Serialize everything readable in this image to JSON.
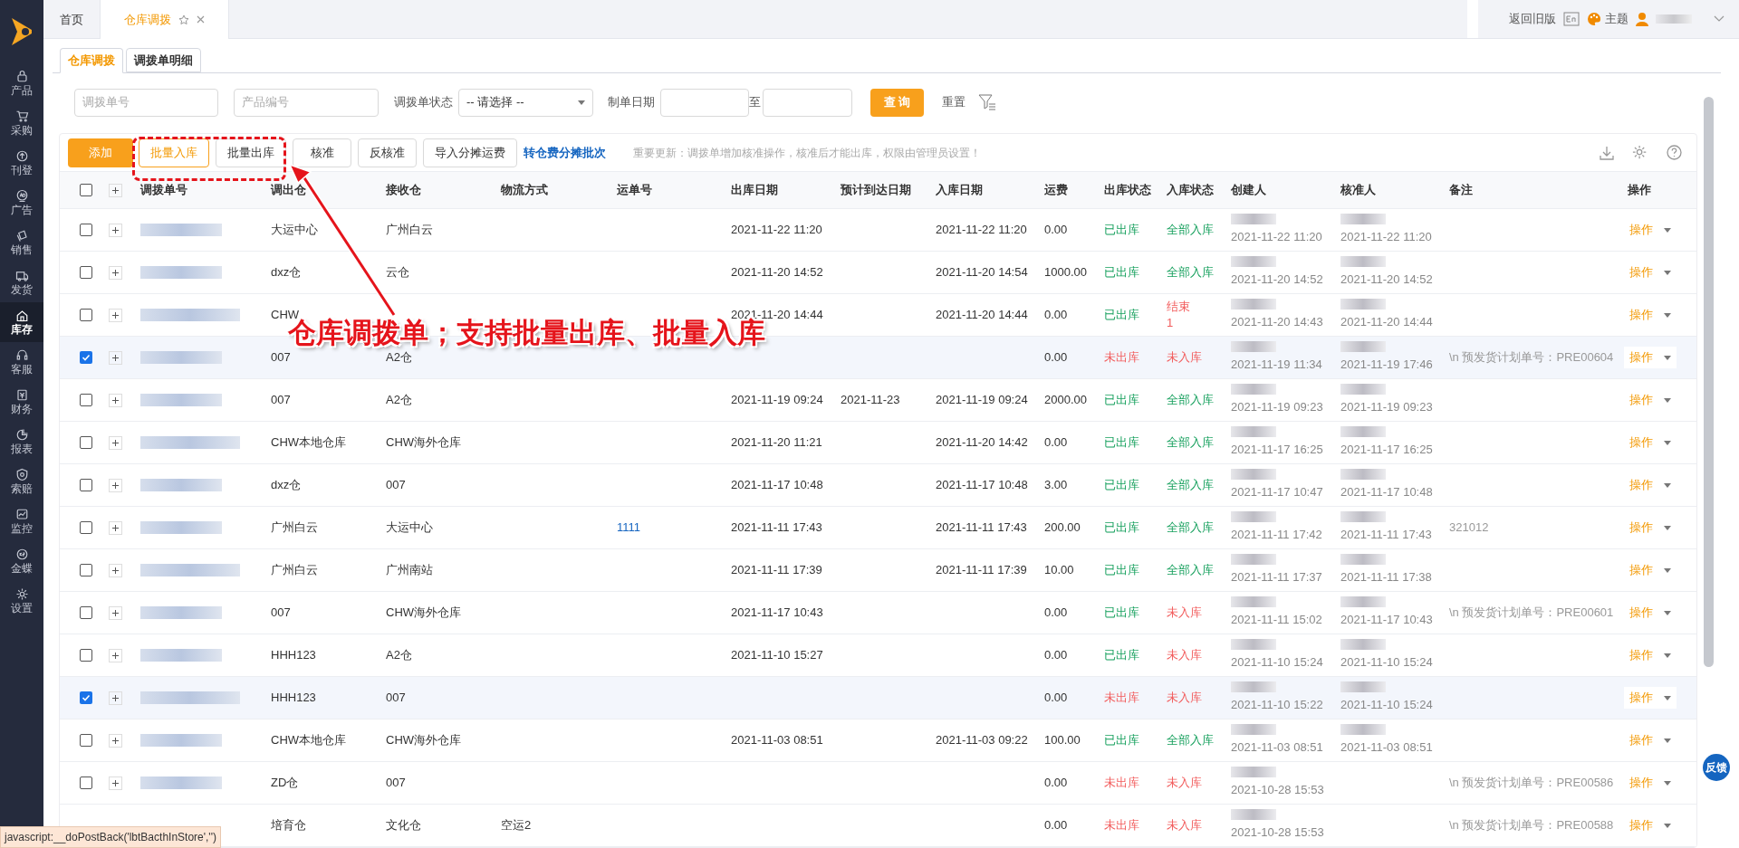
{
  "sidebar": {
    "items": [
      {
        "label": "产品",
        "selected": false
      },
      {
        "label": "采购",
        "selected": false
      },
      {
        "label": "刊登",
        "selected": false
      },
      {
        "label": "广告",
        "selected": false
      },
      {
        "label": "销售",
        "selected": false
      },
      {
        "label": "发货",
        "selected": false
      },
      {
        "label": "库存",
        "selected": true
      },
      {
        "label": "客服",
        "selected": false
      },
      {
        "label": "财务",
        "selected": false
      },
      {
        "label": "报表",
        "selected": false
      },
      {
        "label": "索赔",
        "selected": false
      },
      {
        "label": "监控",
        "selected": false
      },
      {
        "label": "金蝶",
        "selected": false
      },
      {
        "label": "设置",
        "selected": false
      }
    ]
  },
  "page_tabs": [
    {
      "label": "首页",
      "selected": false,
      "closable": false
    },
    {
      "label": "仓库调拨",
      "selected": true,
      "closable": true
    }
  ],
  "header_right": {
    "old_version": "返回旧版",
    "theme": "主题"
  },
  "sub_tabs": [
    {
      "label": "仓库调拨",
      "selected": true
    },
    {
      "label": "调拨单明细",
      "selected": false
    }
  ],
  "filters": {
    "order_no": {
      "placeholder": "调拨单号"
    },
    "product_no": {
      "placeholder": "产品编号"
    },
    "status_label": "调拨单状态",
    "status_select": "-- 请选择 --",
    "date_label": "制单日期",
    "date_to": "至",
    "query": "查 询",
    "reset": "重置"
  },
  "toolbar": {
    "buttons": [
      {
        "label": "添加",
        "kind": "primary"
      },
      {
        "label": "批量入库",
        "kind": "outline"
      },
      {
        "label": "批量出库",
        "kind": "plain"
      },
      {
        "label": "核准",
        "kind": "plain"
      },
      {
        "label": "反核准",
        "kind": "plain"
      },
      {
        "label": "导入分摊运费",
        "kind": "plain"
      },
      {
        "label": "转仓费分摊批次",
        "kind": "link"
      }
    ],
    "notice": "重要更新：调拨单增加核准操作，核准后才能出库，权限由管理员设置！"
  },
  "table": {
    "select_all": {
      "checked": false
    },
    "columns": [
      "调拨单号",
      "调出仓",
      "接收仓",
      "物流方式",
      "运单号",
      "出库日期",
      "预计到达日期",
      "入库日期",
      "运费",
      "出库状态",
      "入库状态",
      "创建人",
      "核准人",
      "备注",
      "操作"
    ],
    "rows": [
      {
        "checked": false,
        "from": "大运中心",
        "to": "广州白云",
        "out_date": "2021-11-22 11:20",
        "in_date": "2021-11-22 11:20",
        "freight": "0.00",
        "out_status": {
          "text": "已出库",
          "kind": "ok"
        },
        "in_status": {
          "text": "全部入库",
          "kind": "ok"
        },
        "created": "2021-11-22 11:20",
        "approved": "2021-11-22 11:20",
        "action": "操作"
      },
      {
        "checked": false,
        "from": "dxz仓",
        "to": "云仓",
        "out_date": "2021-11-20 14:52",
        "in_date": "2021-11-20 14:54",
        "freight": "1000.00",
        "out_status": {
          "text": "已出库",
          "kind": "ok"
        },
        "in_status": {
          "text": "全部入库",
          "kind": "ok"
        },
        "created": "2021-11-20 14:52",
        "approved": "2021-11-20 14:52",
        "action": "操作"
      },
      {
        "checked": false,
        "from": "CHW",
        "out_date": "2021-11-20 14:44",
        "in_date": "2021-11-20 14:44",
        "freight": "0.00",
        "out_status": {
          "text": "已出库",
          "kind": "ok"
        },
        "in_status": {
          "text": "结束",
          "sub": "1",
          "kind": "warn"
        },
        "created": "2021-11-20 14:43",
        "approved": "2021-11-20 14:44",
        "action": "操作"
      },
      {
        "checked": true,
        "from": "007",
        "to": "A2仓",
        "freight": "0.00",
        "out_status": {
          "text": "未出库",
          "kind": "warn"
        },
        "in_status": {
          "text": "未入库",
          "kind": "warn"
        },
        "created": "2021-11-19 11:34",
        "approved": "2021-11-19 17:46",
        "note": "\\n 预发货计划单号：PRE00604",
        "action": "操作"
      },
      {
        "checked": false,
        "from": "007",
        "to": "A2仓",
        "out_date": "2021-11-19 09:24",
        "eta": "2021-11-23",
        "in_date": "2021-11-19 09:24",
        "freight": "2000.00",
        "out_status": {
          "text": "已出库",
          "kind": "ok"
        },
        "in_status": {
          "text": "全部入库",
          "kind": "ok"
        },
        "created": "2021-11-19 09:23",
        "approved": "2021-11-19 09:23",
        "action": "操作"
      },
      {
        "checked": false,
        "from": "CHW本地仓库",
        "to": "CHW海外仓库",
        "out_date": "2021-11-20 11:21",
        "in_date": "2021-11-20 14:42",
        "freight": "0.00",
        "out_status": {
          "text": "已出库",
          "kind": "ok"
        },
        "in_status": {
          "text": "全部入库",
          "kind": "ok"
        },
        "created": "2021-11-17 16:25",
        "approved": "2021-11-17 16:25",
        "action": "操作"
      },
      {
        "checked": false,
        "from": "dxz仓",
        "to": "007",
        "out_date": "2021-11-17 10:48",
        "in_date": "2021-11-17 10:48",
        "freight": "3.00",
        "out_status": {
          "text": "已出库",
          "kind": "ok"
        },
        "in_status": {
          "text": "全部入库",
          "kind": "ok"
        },
        "created": "2021-11-17 10:47",
        "approved": "2021-11-17 10:48",
        "action": "操作"
      },
      {
        "checked": false,
        "from": "广州白云",
        "to": "大运中心",
        "tracking": "1111",
        "out_date": "2021-11-11 17:43",
        "in_date": "2021-11-11 17:43",
        "freight": "200.00",
        "out_status": {
          "text": "已出库",
          "kind": "ok"
        },
        "in_status": {
          "text": "全部入库",
          "kind": "ok"
        },
        "created": "2021-11-11 17:42",
        "approved": "2021-11-11 17:43",
        "note": "321012",
        "action": "操作"
      },
      {
        "checked": false,
        "from": "广州白云",
        "to": "广州南站",
        "out_date": "2021-11-11 17:39",
        "in_date": "2021-11-11 17:39",
        "freight": "10.00",
        "out_status": {
          "text": "已出库",
          "kind": "ok"
        },
        "in_status": {
          "text": "全部入库",
          "kind": "ok"
        },
        "created": "2021-11-11 17:37",
        "approved": "2021-11-11 17:38",
        "action": "操作"
      },
      {
        "checked": false,
        "from": "007",
        "to": "CHW海外仓库",
        "out_date": "2021-11-17 10:43",
        "freight": "0.00",
        "out_status": {
          "text": "已出库",
          "kind": "ok"
        },
        "in_status": {
          "text": "未入库",
          "kind": "warn"
        },
        "created": "2021-11-11 15:02",
        "approved": "2021-11-17 10:43",
        "note": "\\n 预发货计划单号：PRE00601",
        "action": "操作"
      },
      {
        "checked": false,
        "from": "HHH123",
        "to": "A2仓",
        "out_date": "2021-11-10 15:27",
        "freight": "0.00",
        "out_status": {
          "text": "已出库",
          "kind": "ok"
        },
        "in_status": {
          "text": "未入库",
          "kind": "warn"
        },
        "created": "2021-11-10 15:24",
        "approved": "2021-11-10 15:24",
        "action": "操作"
      },
      {
        "checked": true,
        "from": "HHH123",
        "to": "007",
        "freight": "0.00",
        "out_status": {
          "text": "未出库",
          "kind": "warn"
        },
        "in_status": {
          "text": "未入库",
          "kind": "warn"
        },
        "created": "2021-11-10 15:22",
        "approved": "2021-11-10 15:24",
        "action": "操作"
      },
      {
        "checked": false,
        "from": "CHW本地仓库",
        "to": "CHW海外仓库",
        "out_date": "2021-11-03 08:51",
        "in_date": "2021-11-03 09:22",
        "freight": "100.00",
        "out_status": {
          "text": "已出库",
          "kind": "ok"
        },
        "in_status": {
          "text": "全部入库",
          "kind": "ok"
        },
        "created": "2021-11-03 08:51",
        "approved": "2021-11-03 08:51",
        "action": "操作"
      },
      {
        "checked": false,
        "from": "ZD仓",
        "to": "007",
        "freight": "0.00",
        "out_status": {
          "text": "未出库",
          "kind": "warn"
        },
        "in_status": {
          "text": "未入库",
          "kind": "warn"
        },
        "created": "2021-10-28 15:53",
        "note": "\\n 预发货计划单号：PRE00586",
        "action": "操作"
      },
      {
        "from": "培育仓",
        "to": "文化仓",
        "logistics": "空运2",
        "freight": "0.00",
        "out_status": {
          "text": "未出库",
          "kind": "warn"
        },
        "in_status": {
          "text": "未入库",
          "kind": "warn"
        },
        "created": "2021-10-28 15:53",
        "note": "\\n 预发货计划单号：PRE00588",
        "action": "操作"
      }
    ]
  },
  "feedback": "反馈",
  "status_url": "javascript:__doPostBack('lbtBacthInStore','')",
  "annotation": {
    "text": "仓库调拨单；支持批量出库、批量入库"
  }
}
